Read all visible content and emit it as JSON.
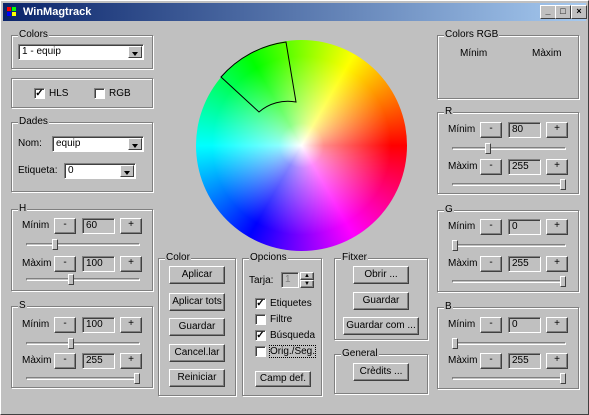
{
  "window": {
    "title": "WinMagtrack",
    "btn_min": "_",
    "btn_max": "□",
    "btn_close": "×"
  },
  "colors": {
    "label": "Colors",
    "selected": "1 - equip"
  },
  "mode": {
    "hls": "HLS",
    "rgb": "RGB",
    "hls_checked": true,
    "rgb_checked": false
  },
  "dades": {
    "label": "Dades",
    "nom_label": "Nom:",
    "nom_value": "equip",
    "etiqueta_label": "Etiqueta:",
    "etiqueta_value": "0"
  },
  "h": {
    "label": "H",
    "min_label": "Mínim",
    "min_value": "60",
    "max_label": "Màxim",
    "max_value": "100",
    "min_level": 0.24,
    "max_level": 0.39
  },
  "s": {
    "label": "S",
    "min_label": "Mínim",
    "min_value": "100",
    "max_label": "Màxim",
    "max_value": "255",
    "min_level": 0.39,
    "max_level": 1.0
  },
  "step": {
    "minus": "-",
    "plus": "+"
  },
  "color_group": {
    "label": "Color",
    "buttons": [
      "Aplicar",
      "Aplicar tots",
      "Guardar",
      "Cancel.lar",
      "Reiniciar"
    ]
  },
  "opcions": {
    "label": "Opcions",
    "tarja_label": "Tarja:",
    "tarja_value": "1",
    "checks": [
      {
        "label": "Etiquetes",
        "checked": true
      },
      {
        "label": "Filtre",
        "checked": false
      },
      {
        "label": "Búsqueda",
        "checked": true
      },
      {
        "label": "Orig./Seg.",
        "checked": false
      }
    ],
    "camp_def": "Camp def."
  },
  "fitxer": {
    "label": "Fitxer",
    "buttons": [
      "Obrir ...",
      "Guardar",
      "Guardar com ..."
    ]
  },
  "general": {
    "label": "General",
    "credits": "Crèdits ..."
  },
  "colors_rgb": {
    "label": "Colors RGB",
    "min_label": "Mínim",
    "max_label": "Màxim"
  },
  "r": {
    "label": "R",
    "min_label": "Mínim",
    "min_value": "80",
    "max_label": "Màxim",
    "max_value": "255",
    "min_level": 0.31,
    "max_level": 1.0
  },
  "g": {
    "label": "G",
    "min_label": "Mínim",
    "min_value": "0",
    "max_label": "Màxim",
    "max_value": "255",
    "min_level": 0.0,
    "max_level": 1.0
  },
  "b": {
    "label": "B",
    "min_label": "Mínim",
    "min_value": "0",
    "max_label": "Màxim",
    "max_value": "255",
    "min_level": 0.0,
    "max_level": 1.0
  },
  "accent": {
    "title_from": "#0a246a",
    "title_to": "#a6caf0",
    "face": "#c0c0c0"
  }
}
